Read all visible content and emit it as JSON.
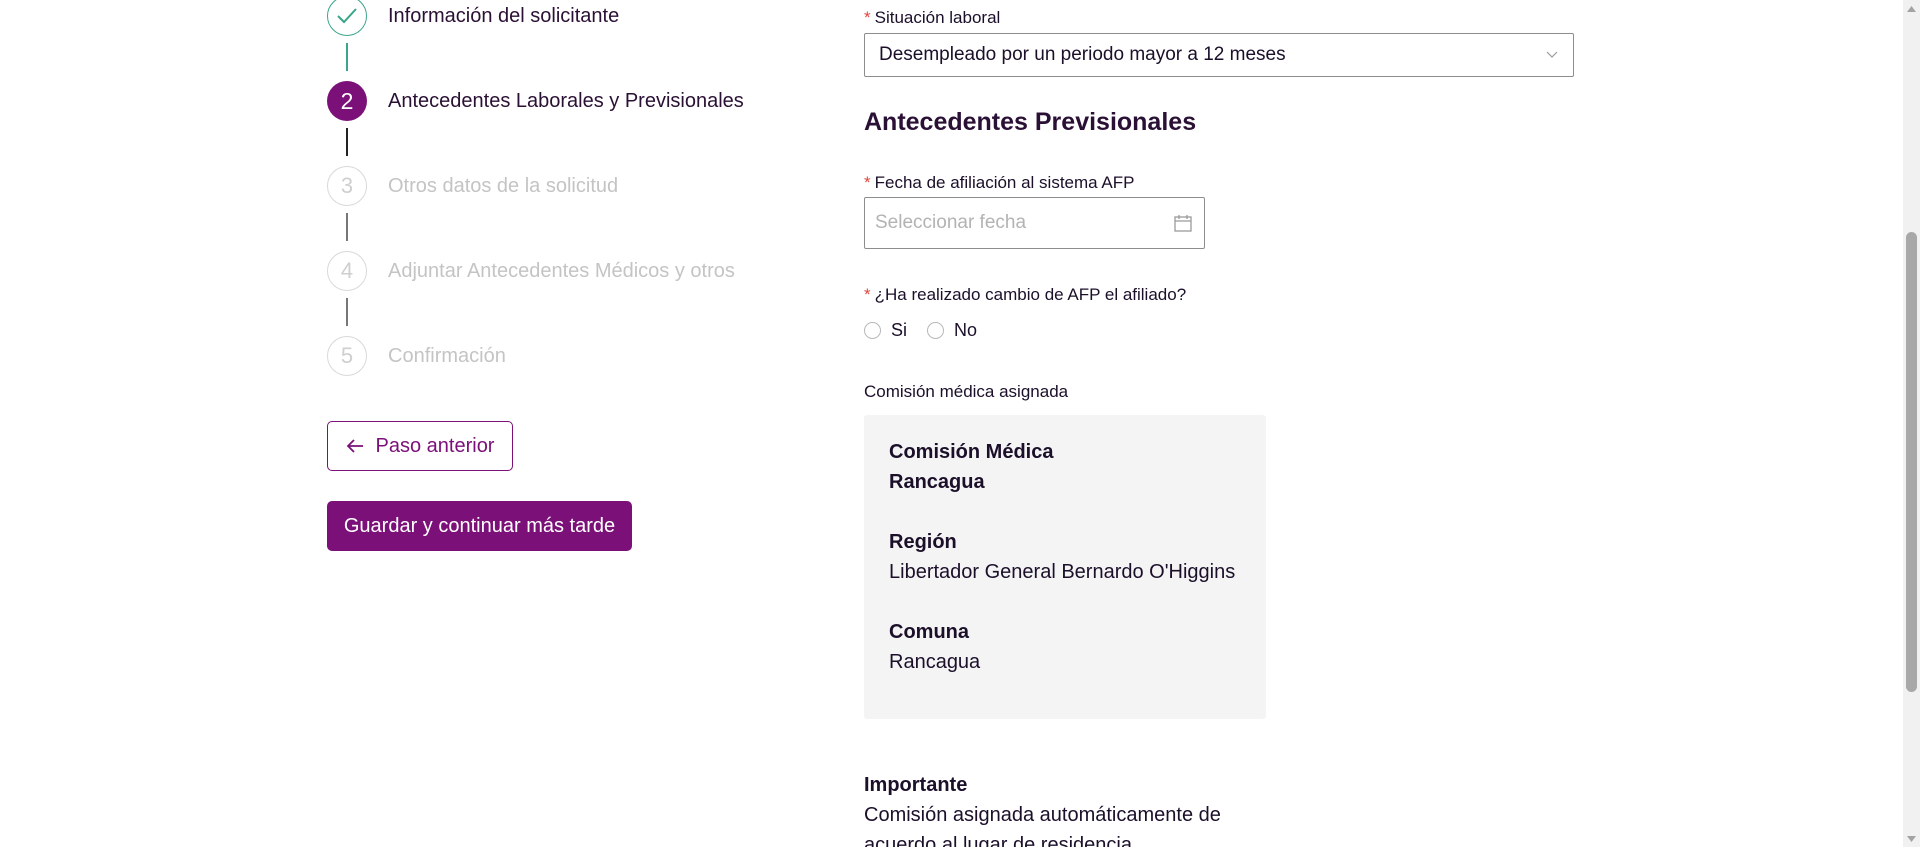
{
  "stepper": {
    "steps": [
      {
        "label": "Información del solicitante",
        "number": "",
        "state": "done"
      },
      {
        "label": "Antecedentes Laborales y Previsionales",
        "number": "2",
        "state": "active"
      },
      {
        "label": "Otros datos de la solicitud",
        "number": "3",
        "state": "pending"
      },
      {
        "label": "Adjuntar Antecedentes Médicos y otros",
        "number": "4",
        "state": "pending"
      },
      {
        "label": "Confirmación",
        "number": "5",
        "state": "pending"
      }
    ],
    "back_label": "Paso anterior",
    "save_label": "Guardar y continuar más tarde"
  },
  "form": {
    "employment": {
      "label": "Situación laboral",
      "value": "Desempleado por un periodo mayor a 12 meses"
    },
    "section_title": "Antecedentes Previsionales",
    "afp_date": {
      "label": "Fecha de afiliación al sistema AFP",
      "placeholder": "Seleccionar fecha"
    },
    "afp_change": {
      "label": "¿Ha realizado cambio de AFP el afiliado?",
      "option_yes": "Si",
      "option_no": "No"
    },
    "commission": {
      "label": "Comisión médica asignada",
      "name": "Comisión Médica Rancagua",
      "region_label": "Región",
      "region_value": "Libertador General Bernardo O'Higgins",
      "comuna_label": "Comuna",
      "comuna_value": "Rancagua"
    },
    "important": {
      "title": "Importante",
      "text": "Comisión asignada automáticamente de acuerdo al lugar de residencia"
    },
    "required_mark": "*"
  },
  "colors": {
    "brand": "#7b1078",
    "done": "#3aa58a",
    "required": "#e0453c"
  }
}
